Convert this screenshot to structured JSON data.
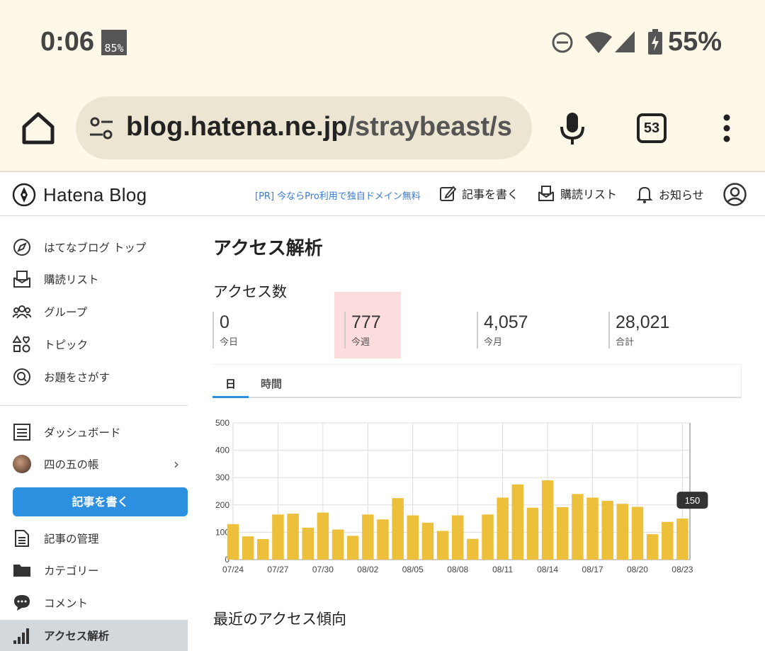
{
  "status": {
    "time": "0:06",
    "temp_badge": "85%",
    "battery": "55%",
    "icons": [
      "dnd-icon",
      "wifi-icon",
      "signal-icon",
      "battery-charging-icon"
    ]
  },
  "browser": {
    "url_host": "blog.hatena.ne.jp",
    "url_path": "/straybeast/s",
    "tab_count": "53"
  },
  "header": {
    "logo": "Hatena Blog",
    "pr_link": "[PR] 今ならPro利用で独自ドメイン無料",
    "write": "記事を書く",
    "reading_list": "購読リスト",
    "notifications": "お知らせ"
  },
  "sidebar": {
    "top_items": [
      {
        "label": "はてなブログ トップ",
        "icon": "compass-icon"
      },
      {
        "label": "購読リスト",
        "icon": "reading-list-icon"
      },
      {
        "label": "グループ",
        "icon": "group-icon"
      },
      {
        "label": "トピック",
        "icon": "topic-icon"
      },
      {
        "label": "お題をさがす",
        "icon": "odai-search-icon"
      }
    ],
    "dashboard": "ダッシュボード",
    "blog_name": "四の五の帳",
    "write_button": "記事を書く",
    "bottom_items": [
      {
        "label": "記事の管理",
        "icon": "document-icon"
      },
      {
        "label": "カテゴリー",
        "icon": "folder-icon"
      },
      {
        "label": "コメント",
        "icon": "comment-icon"
      },
      {
        "label": "アクセス解析",
        "icon": "analytics-icon"
      }
    ]
  },
  "main": {
    "title": "アクセス解析",
    "access_section": "アクセス数",
    "stats": [
      {
        "value": "0",
        "label": "今日"
      },
      {
        "value": "777",
        "label": "今週"
      },
      {
        "value": "4,057",
        "label": "今月"
      },
      {
        "value": "28,021",
        "label": "合計"
      }
    ],
    "tabs": [
      "日",
      "時間"
    ],
    "recent_section": "最近のアクセス傾向"
  },
  "colors": {
    "bar": "#ecc03a",
    "accent": "#2d8fe0",
    "highlight": "#fcdcdc",
    "chrome_bg": "#fef8e8"
  },
  "chart_data": {
    "type": "bar",
    "categories": [
      "07/24",
      "07/25",
      "07/26",
      "07/27",
      "07/28",
      "07/29",
      "07/30",
      "07/31",
      "08/01",
      "08/02",
      "08/03",
      "08/04",
      "08/05",
      "08/06",
      "08/07",
      "08/08",
      "08/09",
      "08/10",
      "08/11",
      "08/12",
      "08/13",
      "08/14",
      "08/15",
      "08/16",
      "08/17",
      "08/18",
      "08/19",
      "08/20",
      "08/21",
      "08/22",
      "08/23"
    ],
    "tick_labels": [
      "07/24",
      "07/27",
      "07/30",
      "08/02",
      "08/05",
      "08/08",
      "08/11",
      "08/14",
      "08/17",
      "08/20",
      "08/23"
    ],
    "values": [
      130,
      85,
      75,
      165,
      168,
      117,
      172,
      110,
      87,
      165,
      147,
      225,
      162,
      135,
      105,
      162,
      76,
      165,
      227,
      275,
      190,
      290,
      192,
      240,
      227,
      215,
      204,
      193,
      93,
      138,
      150
    ],
    "ylim": [
      0,
      500
    ],
    "yticks": [
      0,
      100,
      200,
      300,
      400,
      500
    ],
    "tooltip": {
      "category": "08/23",
      "text": "150"
    },
    "grid": true
  }
}
